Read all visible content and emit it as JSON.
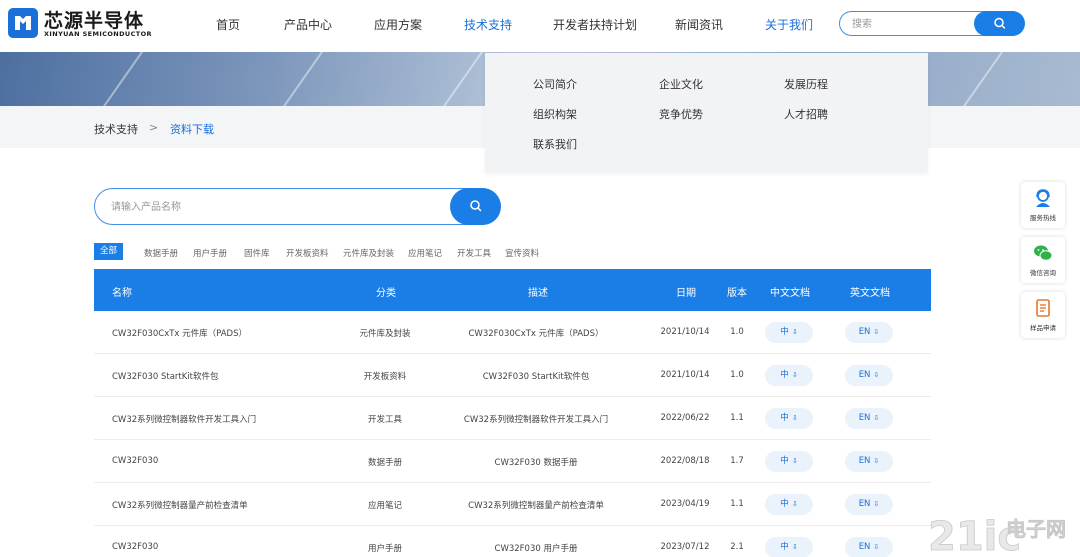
{
  "brand": {
    "name": "芯源半导体",
    "subtitle": "XINYUAN SEMICONDUCTOR"
  },
  "nav": {
    "items": [
      "首页",
      "产品中心",
      "应用方案",
      "技术支持",
      "开发者扶持计划",
      "新闻资讯",
      "关于我们"
    ],
    "active_index": 3,
    "search_placeholder": "搜索"
  },
  "breadcrumb": {
    "parent": "技术支持",
    "separator": ">",
    "current": "资料下载"
  },
  "dropdown": {
    "items": [
      "公司简介",
      "企业文化",
      "发展历程",
      "组织构架",
      "竞争优势",
      "人才招聘",
      "联系我们"
    ]
  },
  "product_search": {
    "placeholder": "请输入产品名称"
  },
  "filter_tabs": [
    "全部",
    "数据手册",
    "用户手册",
    "固件库",
    "开发板资料",
    "元件库及封装",
    "应用笔记",
    "开发工具",
    "宣传资料"
  ],
  "table": {
    "headers": [
      "名称",
      "分类",
      "描述",
      "日期",
      "版本",
      "中文文档",
      "英文文档"
    ],
    "cn_label": "中",
    "en_label": "EN",
    "rows": [
      {
        "name": "CW32F030CxTx 元件库（PADS）",
        "category": "元件库及封装",
        "description": "CW32F030CxTx 元件库（PADS）",
        "date": "2021/10/14",
        "version": "1.0"
      },
      {
        "name": "CW32F030 StartKit软件包",
        "category": "开发板资料",
        "description": "CW32F030 StartKit软件包",
        "date": "2021/10/14",
        "version": "1.0"
      },
      {
        "name": "CW32系列微控制器软件开发工具入门",
        "category": "开发工具",
        "description": "CW32系列微控制器软件开发工具入门",
        "date": "2022/06/22",
        "version": "1.1"
      },
      {
        "name": "CW32F030",
        "category": "数据手册",
        "description": "CW32F030 数据手册",
        "date": "2022/08/18",
        "version": "1.7"
      },
      {
        "name": "CW32系列微控制器量产前检查清单",
        "category": "应用笔记",
        "description": "CW32系列微控制器量产前检查清单",
        "date": "2023/04/19",
        "version": "1.1"
      },
      {
        "name": "CW32F030",
        "category": "用户手册",
        "description": "CW32F030 用户手册",
        "date": "2023/07/12",
        "version": "2.1"
      }
    ]
  },
  "side_bar": {
    "items": [
      "服务热线",
      "微信咨询",
      "样品申请"
    ]
  },
  "watermark": {
    "text": "21ic电子网"
  },
  "colors": {
    "primary": "#1a7ee6",
    "link": "#1a6fd8",
    "text": "#333333"
  }
}
